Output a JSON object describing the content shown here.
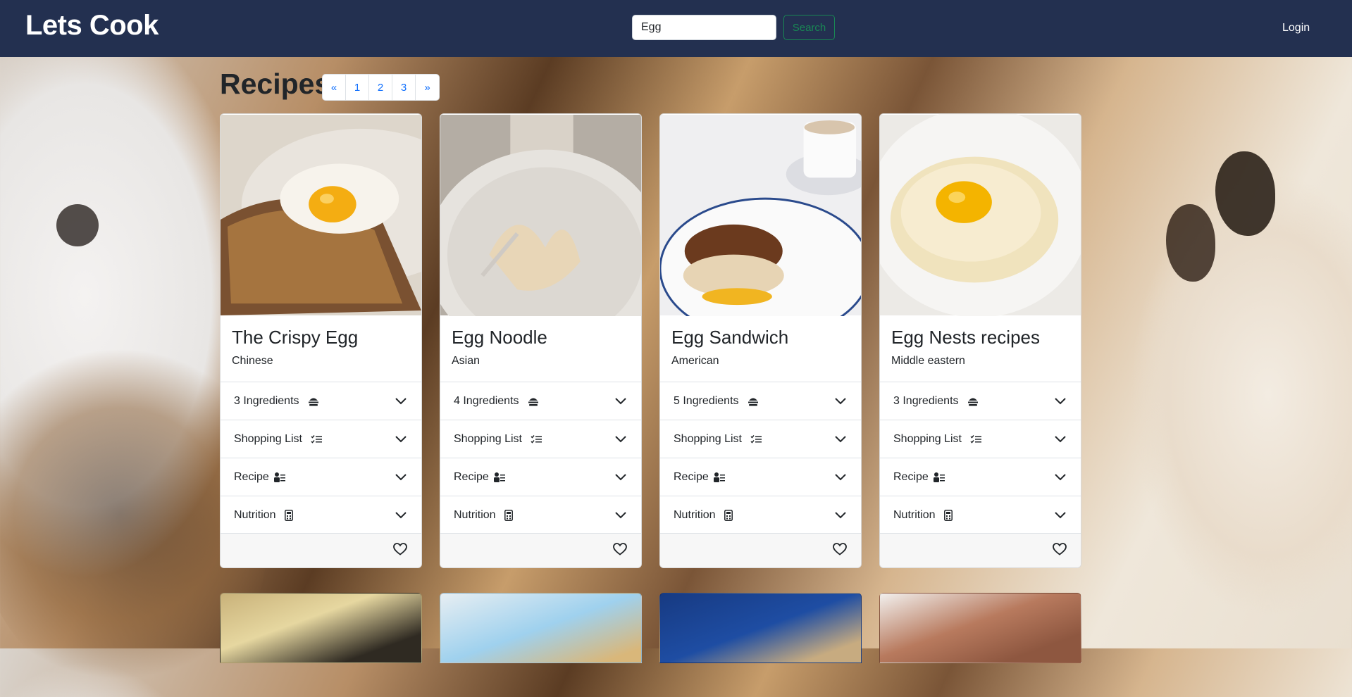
{
  "header": {
    "brand": "Lets Cook",
    "search_value": "Egg",
    "search_button": "Search",
    "login": "Login"
  },
  "main": {
    "title": "Recipes",
    "pagination": [
      "«",
      "1",
      "2",
      "3",
      "»"
    ]
  },
  "cards": [
    {
      "title": "The Crispy Egg",
      "cuisine": "Chinese",
      "ingredients": "3 Ingredients",
      "shopping": "Shopping List",
      "recipe": "Recipe",
      "nutrition": "Nutrition",
      "image_colors": [
        "#6b4a2f",
        "#e7e1d8",
        "#f2b51b"
      ]
    },
    {
      "title": "Egg Noodle",
      "cuisine": "Asian",
      "ingredients": "4 Ingredients",
      "shopping": "Shopping List",
      "recipe": "Recipe",
      "nutrition": "Nutrition",
      "image_colors": [
        "#b5aea4",
        "#d8c9b0",
        "#ebe6de"
      ]
    },
    {
      "title": "Egg Sandwich",
      "cuisine": "American",
      "ingredients": "5 Ingredients",
      "shopping": "Shopping List",
      "recipe": "Recipe",
      "nutrition": "Nutrition",
      "image_colors": [
        "#f1f1f3",
        "#8a4a22",
        "#f3b92a"
      ]
    },
    {
      "title": "Egg Nests recipes",
      "cuisine": "Middle eastern",
      "ingredients": "3 Ingredients",
      "shopping": "Shopping List",
      "recipe": "Recipe",
      "nutrition": "Nutrition",
      "image_colors": [
        "#f0ece6",
        "#e8cf8a",
        "#f4b800"
      ]
    }
  ],
  "colors": {
    "navbar": "#233050",
    "search_border": "#198754",
    "link": "#0d6efd"
  },
  "icons": {
    "ingredients": "burger-icon",
    "shopping": "checklist-icon",
    "recipe": "recipe-card-icon",
    "nutrition": "calculator-icon",
    "chevron": "chevron-down-icon",
    "favorite": "heart-icon"
  }
}
